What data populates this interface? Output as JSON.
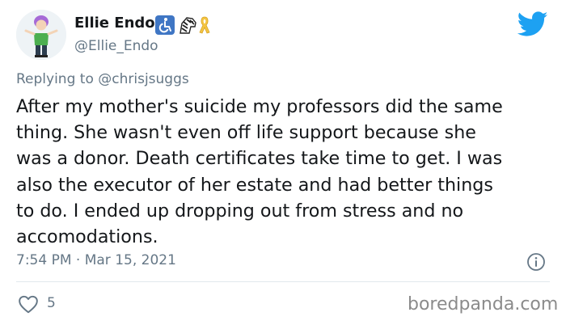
{
  "author": {
    "display_name": "Ellie Endo",
    "handle": "@Ellie_Endo",
    "name_emojis": [
      "accessible-wheelchair-icon",
      "zebra-icon",
      "awareness-ribbon-icon"
    ]
  },
  "reply": {
    "prefix": "Replying to ",
    "mention": "@chrisjsuggs"
  },
  "tweet": {
    "text": "After my mother's suicide my professors did the same\nthing. She wasn't even off life support because she\nwas a donor. Death certificates take time to get. I was\nalso the executor of her estate and had better things\nto do. I ended up dropping out from stress and no\naccomodations.",
    "timestamp": "7:54 PM · Mar 15, 2021",
    "likes": "5"
  },
  "watermark": "boredpanda.com",
  "colors": {
    "twitter_blue": "#1da1f2",
    "muted_text": "#657786",
    "divider": "#e1e8ed",
    "ribbon_gold": "#f5c542"
  }
}
